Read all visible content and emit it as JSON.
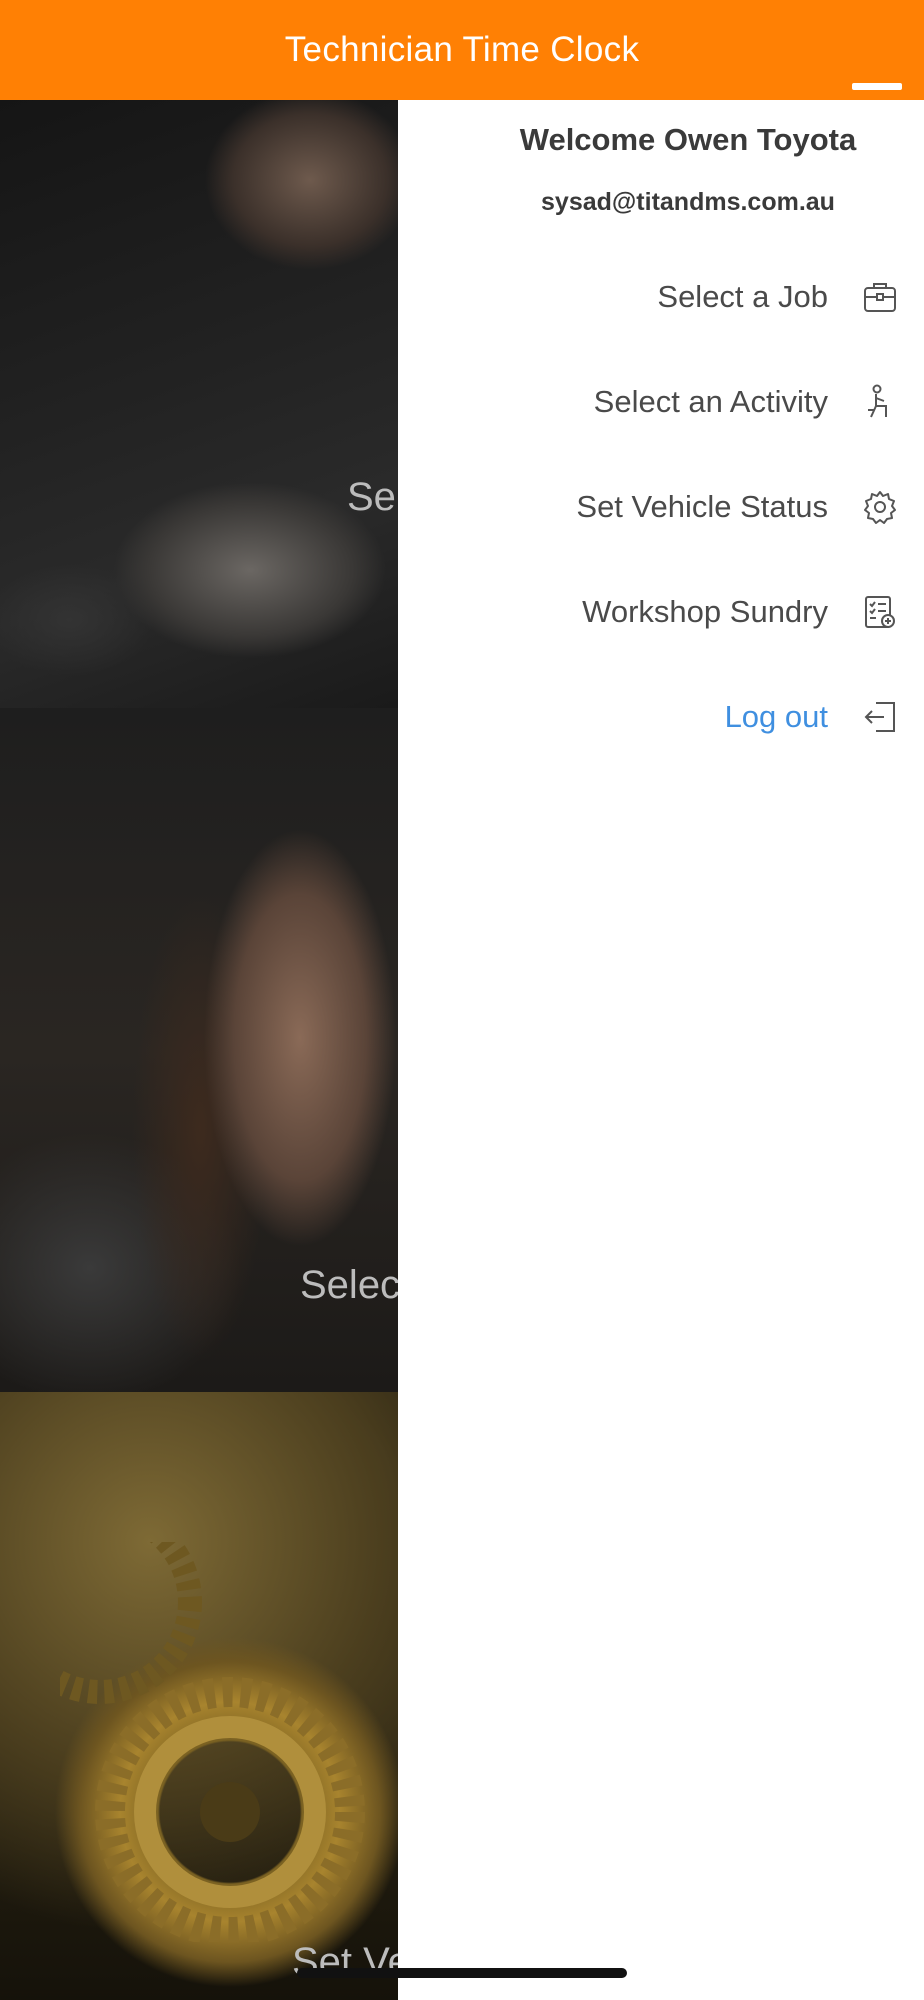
{
  "header": {
    "title": "Technician Time Clock",
    "toggle_icon": "menu-toggle-icon",
    "color": "#ff8004"
  },
  "background_tiles": [
    {
      "label": "Sel",
      "image": "engine-bay-photo"
    },
    {
      "label": "Selec",
      "image": "hand-on-clipboard-photo"
    },
    {
      "label": "Set Ve",
      "image": "gears-photo"
    }
  ],
  "drawer": {
    "welcome": "Welcome Owen Toyota",
    "email": "sysad@titandms.com.au",
    "items": [
      {
        "label": "Select a Job",
        "icon": "briefcase-icon"
      },
      {
        "label": "Select an Activity",
        "icon": "technician-person-icon"
      },
      {
        "label": "Set Vehicle Status",
        "icon": "gear-icon"
      },
      {
        "label": "Workshop Sundry",
        "icon": "checklist-add-icon"
      },
      {
        "label": "Log out",
        "icon": "logout-icon",
        "color": "#3f8fe0"
      }
    ]
  }
}
